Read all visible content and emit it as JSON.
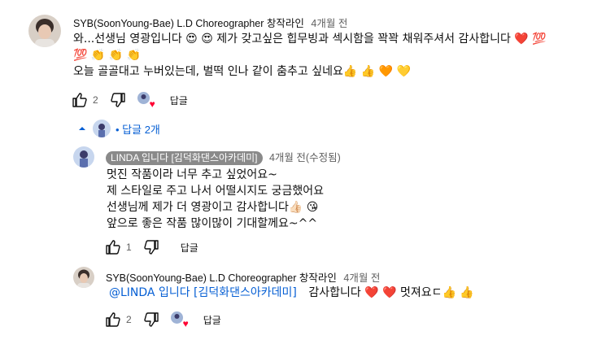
{
  "comments": [
    {
      "author": "SYB(SoonYoung-Bae) L.D Choreographer",
      "channel": "창작라인",
      "time": "4개월 전",
      "lines": [
        "와...선생님 영광입니다 😍 😍 제가 갖고싶은 힙무빙과 섹시함을 꽉꽉 채워주셔서 감사합니다 ❤️ 💯",
        "💯 👏 👏 👏",
        "오늘 골골대고 누버있는데, 벌떡 인나 같이 춤추고 싶네요👍 👍 🧡 💛"
      ],
      "likes": "2",
      "reply_label": "답글"
    }
  ],
  "replies_toggle": "• 답글 2개",
  "replies": [
    {
      "author": "LINDA 입니다 [김덕화댄스아카데미]",
      "time": "4개월 전(수정됨)",
      "lines": [
        "멋진 작품이라 너무 추고 싶었어요~",
        "제 스타일로 주고 나서 어떨시지도 궁금했어요",
        "선생님께 제가 더 영광이고 감사합니다👍🏻 😘",
        "앞으로 좋은 작품 많이많이 기대할께요~^^"
      ],
      "likes": "1",
      "reply_label": "답글"
    },
    {
      "author": "SYB(SoonYoung-Bae) L.D Choreographer",
      "channel": "창작라인",
      "time": "4개월 전",
      "mention": "@LINDA 입니다 [김덕화댄스아카데미]",
      "text": "감사합니다 ❤️ ❤️ 멋져요ㄷ👍 👍",
      "likes": "2",
      "reply_label": "답글"
    }
  ],
  "colors": {
    "link": "#065fd4",
    "chip": "#8a8a8a",
    "heart": "#ff0033",
    "meta": "#606060"
  },
  "icons": [
    "like-icon",
    "dislike-icon",
    "creator-heart-icon",
    "caret-up-icon"
  ]
}
